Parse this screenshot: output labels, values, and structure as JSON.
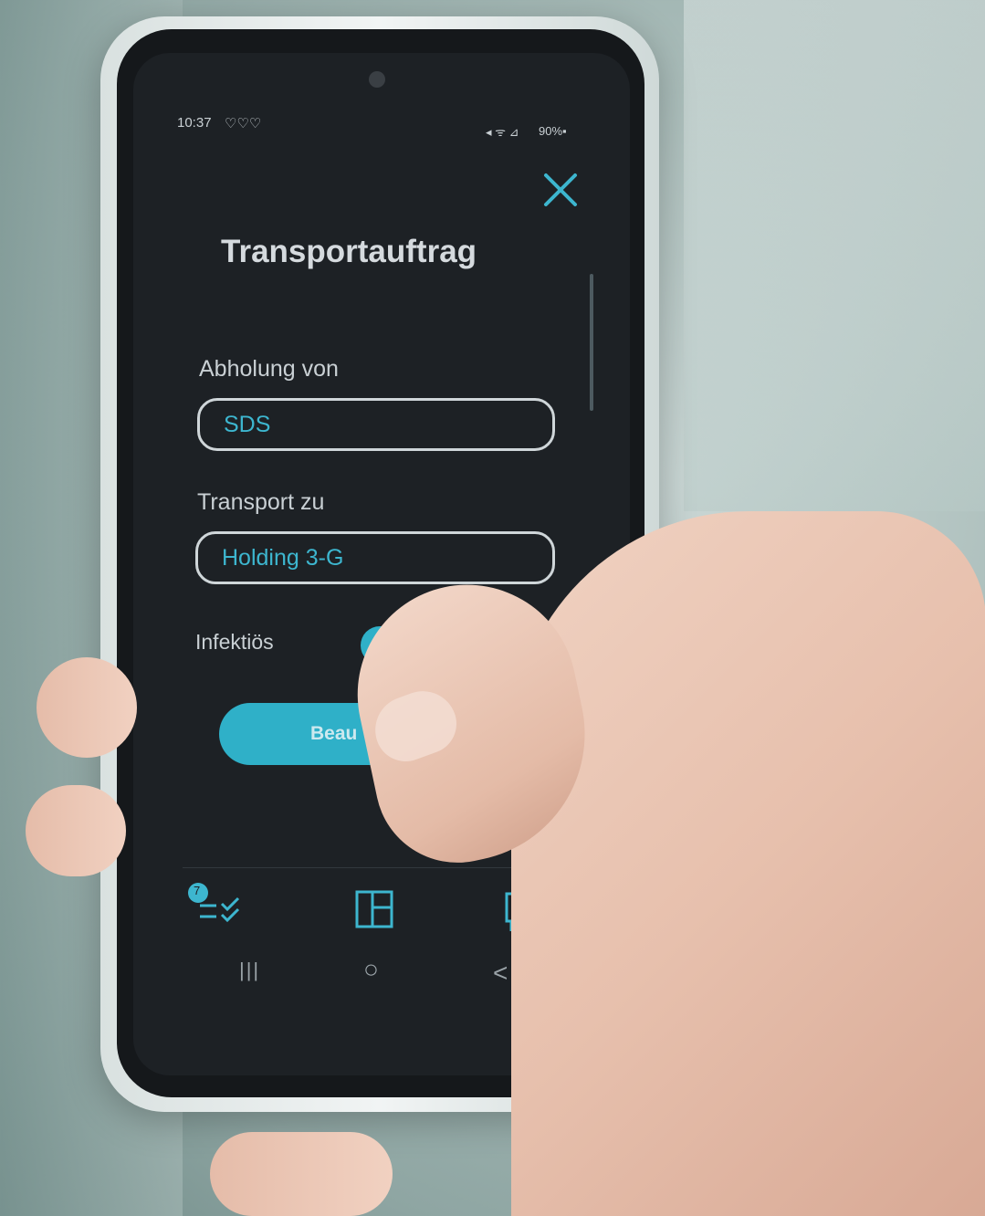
{
  "status_bar": {
    "time": "10:37",
    "notification_icons": "♡♡♡",
    "signal_icons": "◂ ᯤ ⊿",
    "battery": "90%▪"
  },
  "screen": {
    "title": "Transportauftrag",
    "pickup": {
      "label": "Abholung von",
      "value": "SDS"
    },
    "destination": {
      "label": "Transport zu",
      "value": "Holding 3-G"
    },
    "infectious": {
      "label": "Infektiös",
      "toggle_on": true
    },
    "submit_button_visible_text": "Beau"
  },
  "bottom_nav": {
    "badge": "7",
    "icons": [
      "tasks-icon",
      "dashboard-icon",
      "messages-icon"
    ]
  },
  "system_nav": {
    "recents": "|||",
    "home": "○",
    "back": "<"
  },
  "colors": {
    "accent": "#2fb0c8",
    "screen_bg": "#1d2125",
    "text": "#c9d0d4"
  }
}
